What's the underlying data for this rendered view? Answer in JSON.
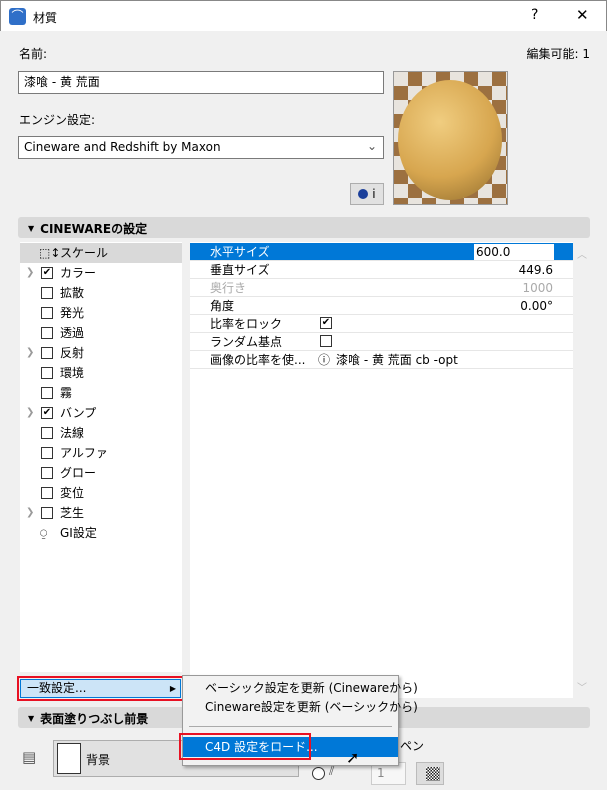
{
  "window": {
    "title": "材質",
    "help": "?",
    "close": "✕"
  },
  "name_label": "名前:",
  "editable": "編集可能: 1",
  "name_value": "漆喰 - 黄 荒面",
  "engine_label": "エンジン設定:",
  "engine_value": "Cineware and Redshift by Maxon",
  "info_button": "i",
  "cineware_section": "CINEWAREの設定",
  "channels": [
    {
      "label": "スケール"
    },
    {
      "label": "カラー",
      "checked": true,
      "expand": true
    },
    {
      "label": "拡散"
    },
    {
      "label": "発光"
    },
    {
      "label": "透過"
    },
    {
      "label": "反射",
      "expand": true
    },
    {
      "label": "環境"
    },
    {
      "label": "霧"
    },
    {
      "label": "バンプ",
      "checked": true,
      "expand": true
    },
    {
      "label": "法線"
    },
    {
      "label": "アルファ"
    },
    {
      "label": "グロー"
    },
    {
      "label": "変位"
    },
    {
      "label": "芝生",
      "expand": true
    },
    {
      "label": "GI設定"
    }
  ],
  "properties": [
    {
      "key": "水平サイズ",
      "value": "600.0"
    },
    {
      "key": "垂直サイズ",
      "value": "449.6"
    },
    {
      "key": "奥行き",
      "value": "1000",
      "disabled": true
    },
    {
      "key": "角度",
      "value": "0.00°"
    },
    {
      "key": "比率をロック",
      "checked": true
    },
    {
      "key": "ランダム基点",
      "checked": false
    },
    {
      "key": "画像の比率を使...",
      "value": "漆喰 - 黄 荒面 cb -opt"
    }
  ],
  "match_button": "一致設定...",
  "menu": {
    "items": [
      "ベーシック設定を更新 (Cinewareから)",
      "Cineware設定を更新 (ベーシックから)",
      "C4D 設定をロード..."
    ]
  },
  "surface_section": "表面塗りつぶし前景",
  "fill_label": "背景",
  "pen_label": "ペン",
  "pen_value": "1",
  "colors": {
    "accent": "#0078d7",
    "highlight_outline": "#e81123"
  }
}
